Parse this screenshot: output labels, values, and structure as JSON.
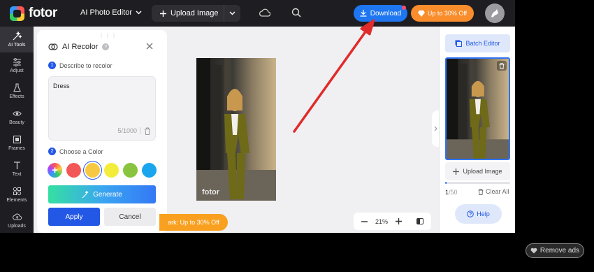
{
  "app": {
    "logo_text": "fotor"
  },
  "topbar": {
    "editor_menu": "AI Photo Editor",
    "upload_label": "Upload Image",
    "download_label": "Download",
    "promo_label": "Up to 30% Off"
  },
  "rail": {
    "items": [
      {
        "label": "AI Tools",
        "icon": "magic-wand-icon"
      },
      {
        "label": "Adjust",
        "icon": "sliders-icon"
      },
      {
        "label": "Effects",
        "icon": "flask-icon"
      },
      {
        "label": "Beauty",
        "icon": "eye-icon"
      },
      {
        "label": "Frames",
        "icon": "frame-icon"
      },
      {
        "label": "Text",
        "icon": "text-icon"
      },
      {
        "label": "Elements",
        "icon": "shapes-icon"
      },
      {
        "label": "Uploads",
        "icon": "upload-cloud-icon"
      }
    ]
  },
  "panel": {
    "title": "AI Recolor",
    "step1_num": "1",
    "step1_label": "Describe to recolor",
    "textarea_value": "Dress",
    "char_count": "5/1000",
    "step2_num": "2",
    "step2_label": "Choose a Color",
    "colors": [
      "#f25858",
      "#f7c942",
      "#f4ec3a",
      "#8ac43f",
      "#1aa6ee"
    ],
    "selected_color": "#f7c942",
    "generate_label": "Generate",
    "apply_label": "Apply",
    "cancel_label": "Cancel"
  },
  "canvas": {
    "watermark": "fotor",
    "banner_text": "ark: Up to 30% Off",
    "zoom_value": "21%"
  },
  "right_panel": {
    "batch_label": "Batch Editor",
    "upload_label": "Upload Image",
    "count_current": "1",
    "count_total": "/50",
    "progress_fraction": 0.02,
    "clear_label": "Clear All",
    "help_label": "Help"
  },
  "overlay": {
    "remove_ads_label": "Remove ads"
  },
  "colors": {
    "accent": "#2358e6",
    "download": "#1e76f0",
    "promo": "#f98d2c",
    "arrow": "#e02b2b"
  }
}
